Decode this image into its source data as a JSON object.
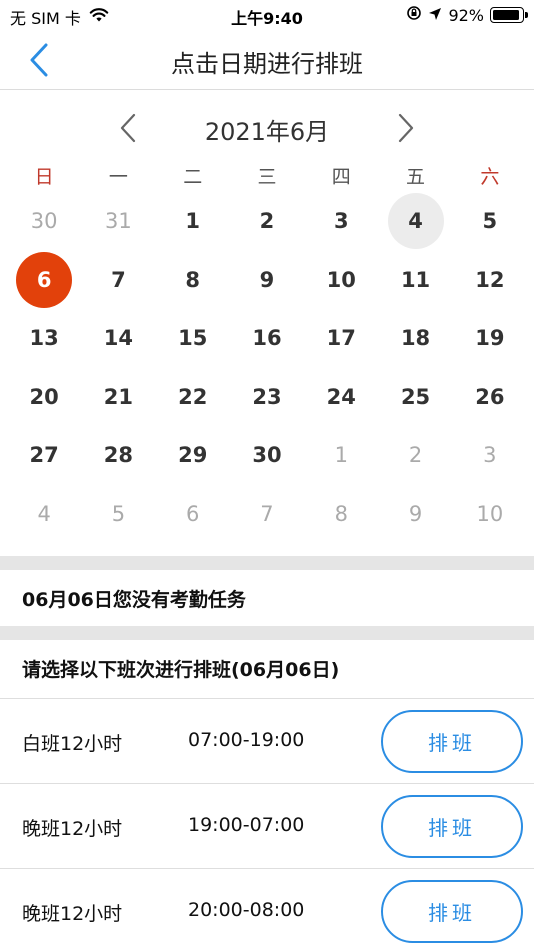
{
  "status_bar": {
    "carrier": "无 SIM 卡",
    "time": "上午9:40",
    "battery": "92%",
    "battery_level": 0.92,
    "icons": [
      "wifi-icon",
      "orientation-lock-icon",
      "location-arrow-icon",
      "battery-icon"
    ]
  },
  "nav": {
    "title": "点击日期进行排班",
    "back_icon": "chevron-left-icon",
    "accent_color": "#2b8de3"
  },
  "calendar": {
    "month_label": "2021年6月",
    "prev_icon": "chevron-left-icon",
    "next_icon": "chevron-right-icon",
    "weekdays": [
      "日",
      "一",
      "二",
      "三",
      "四",
      "五",
      "六"
    ],
    "weekend_color": "#c0392b",
    "selected_color": "#e2410b",
    "today_color": "#ececec",
    "days": [
      {
        "label": "30",
        "other": true
      },
      {
        "label": "31",
        "other": true
      },
      {
        "label": "1"
      },
      {
        "label": "2"
      },
      {
        "label": "3"
      },
      {
        "label": "4",
        "today": true
      },
      {
        "label": "5"
      },
      {
        "label": "6",
        "selected": true
      },
      {
        "label": "7"
      },
      {
        "label": "8"
      },
      {
        "label": "9"
      },
      {
        "label": "10"
      },
      {
        "label": "11"
      },
      {
        "label": "12"
      },
      {
        "label": "13"
      },
      {
        "label": "14"
      },
      {
        "label": "15"
      },
      {
        "label": "16"
      },
      {
        "label": "17"
      },
      {
        "label": "18"
      },
      {
        "label": "19"
      },
      {
        "label": "20"
      },
      {
        "label": "21"
      },
      {
        "label": "22"
      },
      {
        "label": "23"
      },
      {
        "label": "24"
      },
      {
        "label": "25"
      },
      {
        "label": "26"
      },
      {
        "label": "27"
      },
      {
        "label": "28"
      },
      {
        "label": "29"
      },
      {
        "label": "30"
      },
      {
        "label": "1",
        "other": true
      },
      {
        "label": "2",
        "other": true
      },
      {
        "label": "3",
        "other": true
      },
      {
        "label": "4",
        "other": true
      },
      {
        "label": "5",
        "other": true
      },
      {
        "label": "6",
        "other": true
      },
      {
        "label": "7",
        "other": true
      },
      {
        "label": "8",
        "other": true
      },
      {
        "label": "9",
        "other": true
      },
      {
        "label": "10",
        "other": true
      }
    ]
  },
  "attendance_notice": "06月06日您没有考勤任务",
  "shift_prompt": "请选择以下班次进行排班(06月06日)",
  "shifts": [
    {
      "name": "白班12小时",
      "time": "07:00-19:00",
      "button": "排班"
    },
    {
      "name": "晚班12小时",
      "time": "19:00-07:00",
      "button": "排班"
    },
    {
      "name": "晚班12小时",
      "time": "20:00-08:00",
      "button": "排班"
    }
  ]
}
